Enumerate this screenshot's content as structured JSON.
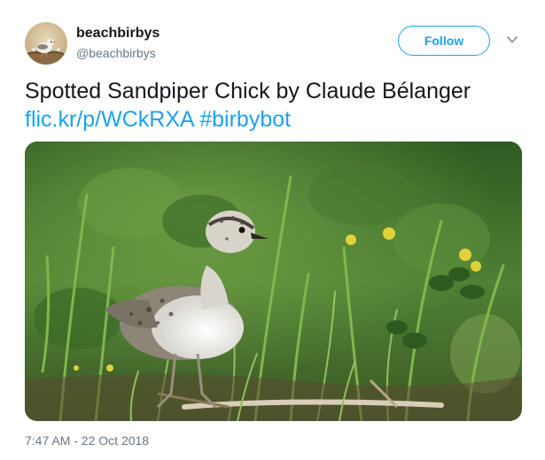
{
  "tweet": {
    "author": {
      "display_name": "beachbirbys",
      "handle": "@beachbirbys",
      "avatar_icon": "bird-avatar"
    },
    "follow_label": "Follow",
    "menu_icon": "chevron-down-icon",
    "text": "Spotted Sandpiper Chick by Claude Bélanger",
    "link": "flic.kr/p/WCkRXA",
    "hashtag": "#birbybot",
    "photo_icon": "sandpiper-chick-photo",
    "timestamp": "7:47 AM - 22 Oct 2018"
  },
  "colors": {
    "accent": "#1da1f2",
    "text": "#14171a",
    "secondary_text": "#657786"
  }
}
